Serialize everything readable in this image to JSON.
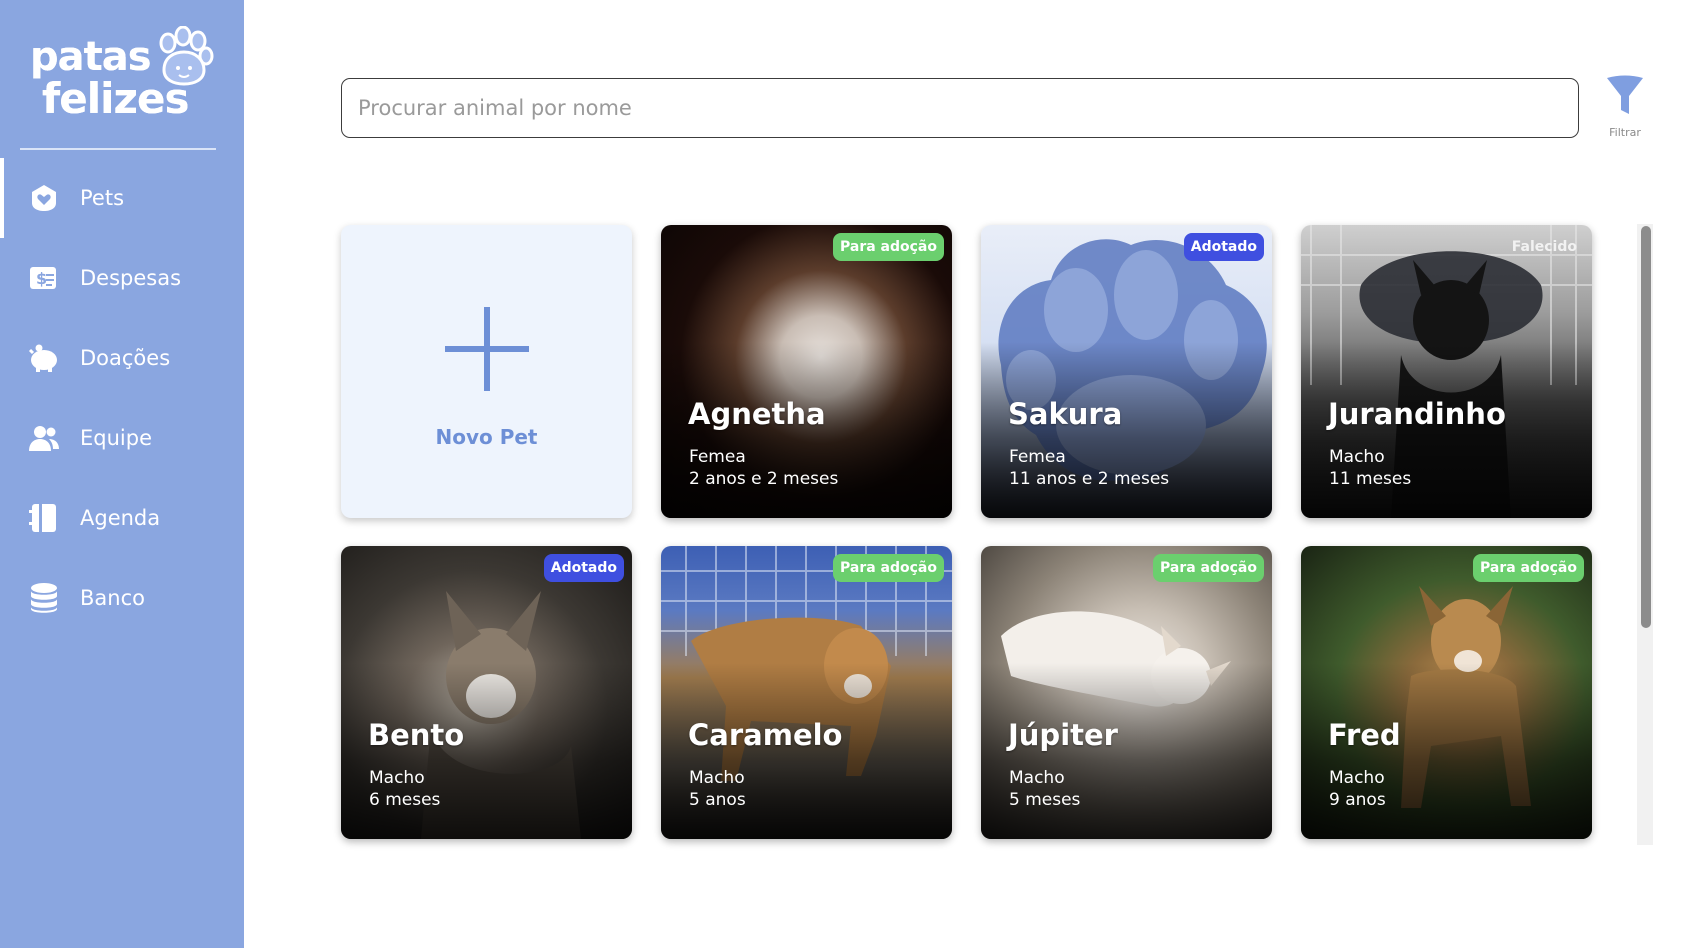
{
  "brand": {
    "line1": "patas",
    "line2": "felizes"
  },
  "sidebar": {
    "items": [
      {
        "label": "Pets",
        "icon": "paw-heart-icon",
        "active": true
      },
      {
        "label": "Despesas",
        "icon": "money-bill-icon",
        "active": false
      },
      {
        "label": "Doações",
        "icon": "piggy-bank-icon",
        "active": false
      },
      {
        "label": "Equipe",
        "icon": "users-icon",
        "active": false
      },
      {
        "label": "Agenda",
        "icon": "agenda-book-icon",
        "active": false
      },
      {
        "label": "Banco",
        "icon": "database-icon",
        "active": false
      }
    ]
  },
  "search": {
    "placeholder": "Procurar animal por nome",
    "value": ""
  },
  "filter": {
    "label": "Filtrar",
    "icon": "funnel-icon"
  },
  "new_pet": {
    "label": "Novo Pet"
  },
  "pets": [
    {
      "name": "Agnetha",
      "sex": "Femea",
      "age": "2 anos e 2 meses",
      "status": "Para adoção"
    },
    {
      "name": "Sakura",
      "sex": "Femea",
      "age": "11 anos e 2 meses",
      "status": "Adotado"
    },
    {
      "name": "Jurandinho",
      "sex": "Macho",
      "age": "11 meses",
      "status": "Falecido"
    },
    {
      "name": "Bento",
      "sex": "Macho",
      "age": "6 meses",
      "status": "Adotado"
    },
    {
      "name": "Caramelo",
      "sex": "Macho",
      "age": "5 anos",
      "status": "Para adoção"
    },
    {
      "name": "Júpiter",
      "sex": "Macho",
      "age": "5 meses",
      "status": "Para adoção"
    },
    {
      "name": "Fred",
      "sex": "Macho",
      "age": "9 anos",
      "status": "Para adoção"
    }
  ],
  "colors": {
    "sidebar": "#8aa6e0",
    "accent": "#6d8fd6",
    "status_adoption": "#6bcf6e",
    "status_adopted": "#3f4fe0"
  }
}
